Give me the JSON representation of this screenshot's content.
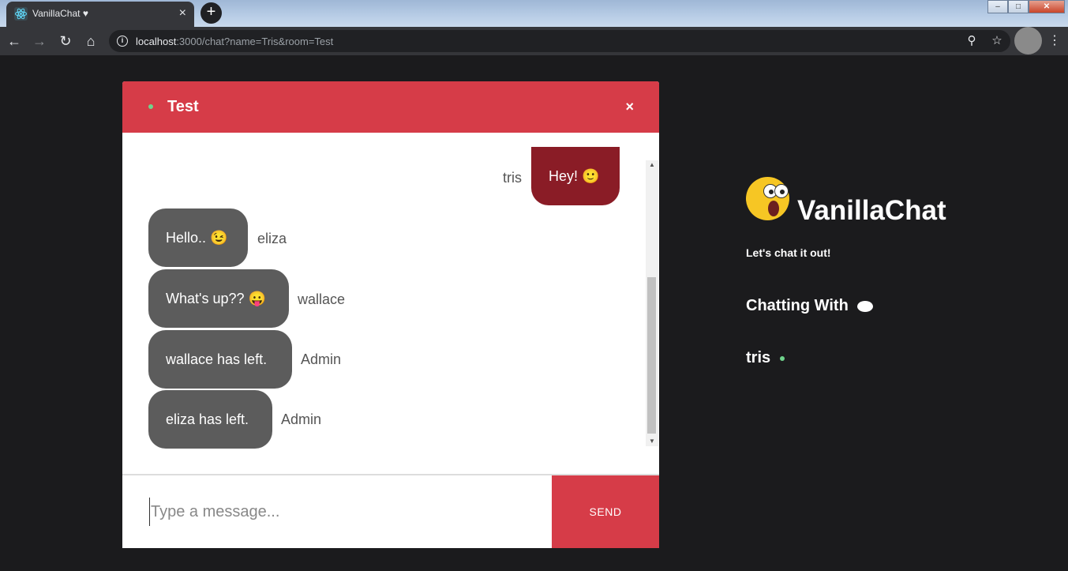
{
  "browser": {
    "tab_title": "VanillaChat ♥",
    "tab_close": "×",
    "new_tab": "+",
    "url_host": "localhost",
    "url_rest": ":3000/chat?name=Tris&room=Test",
    "win_min": "–",
    "win_max": "□",
    "win_close": "✕"
  },
  "chat": {
    "room": "Test",
    "close_label": "×",
    "messages": [
      {
        "text": "Hey! 🙂",
        "sender": "tris",
        "mine": true
      },
      {
        "text": "Hello.. 😉",
        "sender": "eliza",
        "mine": false
      },
      {
        "text": "What's up?? 😛",
        "sender": "wallace",
        "mine": false
      },
      {
        "text": "wallace has left.",
        "sender": "Admin",
        "mine": false
      },
      {
        "text": "eliza has left.",
        "sender": "Admin",
        "mine": false
      }
    ],
    "input_placeholder": "Type a message...",
    "send_label": "SEND"
  },
  "sidebar": {
    "brand": "VanillaChat",
    "tagline": "Let's chat it out!",
    "chatting_with": "Chatting With",
    "users": [
      "tris"
    ]
  },
  "colors": {
    "accent": "#d63c48",
    "my_bubble": "#8a1c26",
    "other_bubble": "#5c5c5c",
    "online": "#6fd38c",
    "background": "#1b1b1d"
  }
}
